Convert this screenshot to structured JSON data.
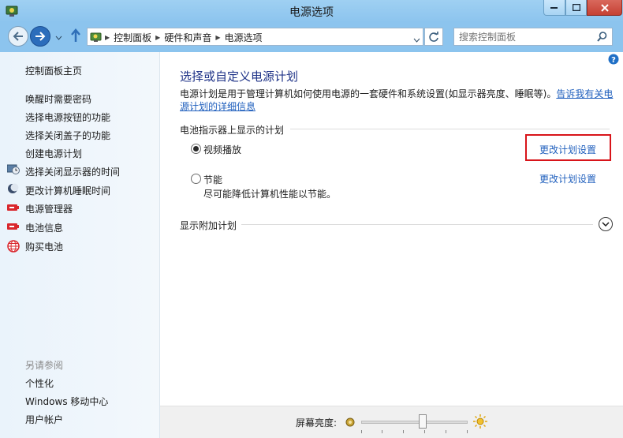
{
  "window": {
    "title": "电源选项",
    "accent": "#8cc4ee",
    "close_color": "#c64133"
  },
  "address": {
    "crumbs": [
      "控制面板",
      "硬件和声音",
      "电源选项"
    ],
    "search_placeholder": "搜索控制面板"
  },
  "sidebar": {
    "home": "控制面板主页",
    "items": [
      {
        "label": "唤醒时需要密码",
        "icon": ""
      },
      {
        "label": "选择电源按钮的功能",
        "icon": ""
      },
      {
        "label": "选择关闭盖子的功能",
        "icon": ""
      },
      {
        "label": "创建电源计划",
        "icon": ""
      },
      {
        "label": "选择关闭显示器的时间",
        "icon": "display-clock-icon"
      },
      {
        "label": "更改计算机睡眠时间",
        "icon": "moon-icon"
      },
      {
        "label": "电源管理器",
        "icon": "battery-icon"
      },
      {
        "label": "电池信息",
        "icon": "battery-icon"
      },
      {
        "label": "购买电池",
        "icon": "globe-icon"
      }
    ],
    "see_also": "另请参阅",
    "see_also_items": [
      "个性化",
      "Windows 移动中心",
      "用户帐户"
    ]
  },
  "main": {
    "heading": "选择或自定义电源计划",
    "description": "电源计划是用于管理计算机如何使用电源的一套硬件和系统设置(如显示器亮度、睡眠等)。",
    "description_link": "告诉我有关电源计划的详细信息",
    "group_title": "电池指示器上显示的计划",
    "plans": [
      {
        "name": "视频播放",
        "selected": true,
        "description": "",
        "link": "更改计划设置"
      },
      {
        "name": "节能",
        "selected": false,
        "description": "尽可能降低计算机性能以节能。",
        "link": "更改计划设置"
      }
    ],
    "highlight_color": "#d8141a",
    "extra_plans": "显示附加计划"
  },
  "bottom": {
    "brightness_label": "屏幕亮度:",
    "brightness_fraction": 0.58
  }
}
